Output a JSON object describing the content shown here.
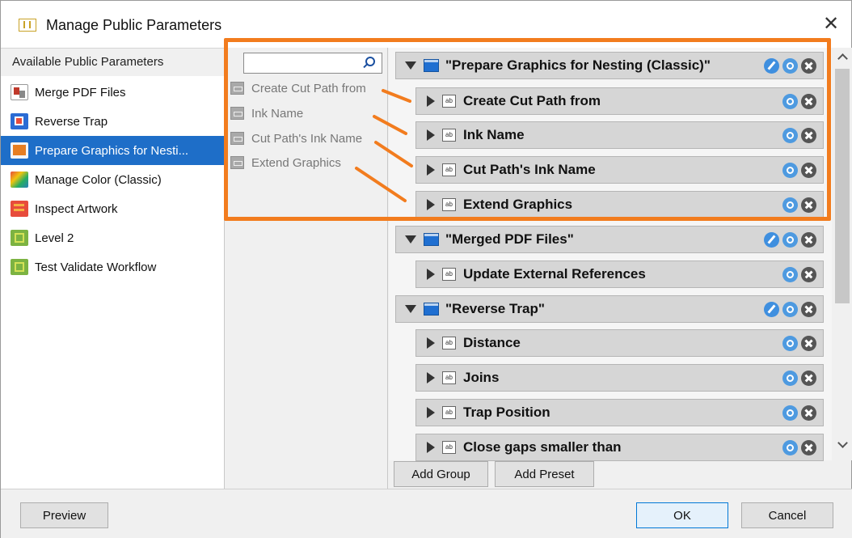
{
  "window": {
    "title": "Manage Public Parameters",
    "close_label": "✕"
  },
  "left": {
    "header": "Available Public Parameters",
    "items": [
      {
        "label": "Merge PDF Files",
        "icon": "merge-pdf-icon",
        "color": "#c0392b"
      },
      {
        "label": "Reverse Trap",
        "icon": "reverse-trap-icon",
        "color": "#2b6cd4"
      },
      {
        "label": "Prepare Graphics for Nesti...",
        "icon": "nesting-icon",
        "color": "#e67e22"
      },
      {
        "label": "Manage Color (Classic)",
        "icon": "color-icon",
        "color": "#27ae60"
      },
      {
        "label": "Inspect Artwork",
        "icon": "inspect-icon",
        "color": "#d35400"
      },
      {
        "label": "Level 2",
        "icon": "level-icon",
        "color": "#6aa84f"
      },
      {
        "label": "Test Validate Workflow",
        "icon": "validate-icon",
        "color": "#6aa84f"
      }
    ]
  },
  "middle": {
    "search_value": "",
    "params": [
      "Create Cut Path from",
      "Ink Name",
      "Cut Path's Ink Name",
      "Extend Graphics"
    ]
  },
  "right": {
    "rows": [
      {
        "type": "group",
        "label": "\"Prepare Graphics for Nesting (Classic)\""
      },
      {
        "type": "param",
        "label": "Create Cut Path from"
      },
      {
        "type": "param",
        "label": "Ink Name"
      },
      {
        "type": "param",
        "label": "Cut Path's Ink Name"
      },
      {
        "type": "param",
        "label": "Extend Graphics"
      },
      {
        "type": "group",
        "label": "\"Merged PDF Files\""
      },
      {
        "type": "param",
        "label": "Update External References"
      },
      {
        "type": "group",
        "label": "\"Reverse Trap\""
      },
      {
        "type": "param",
        "label": "Distance"
      },
      {
        "type": "param",
        "label": "Joins"
      },
      {
        "type": "param",
        "label": "Trap Position"
      },
      {
        "type": "param",
        "label": "Close gaps smaller than"
      }
    ],
    "add_group_label": "Add Group",
    "add_preset_label": "Add Preset"
  },
  "footer": {
    "preview_label": "Preview",
    "ok_label": "OK",
    "cancel_label": "Cancel"
  },
  "colors": {
    "highlight": "#f27c1e",
    "selection": "#1e6ec8",
    "group_icon": "#1f6fd1"
  }
}
